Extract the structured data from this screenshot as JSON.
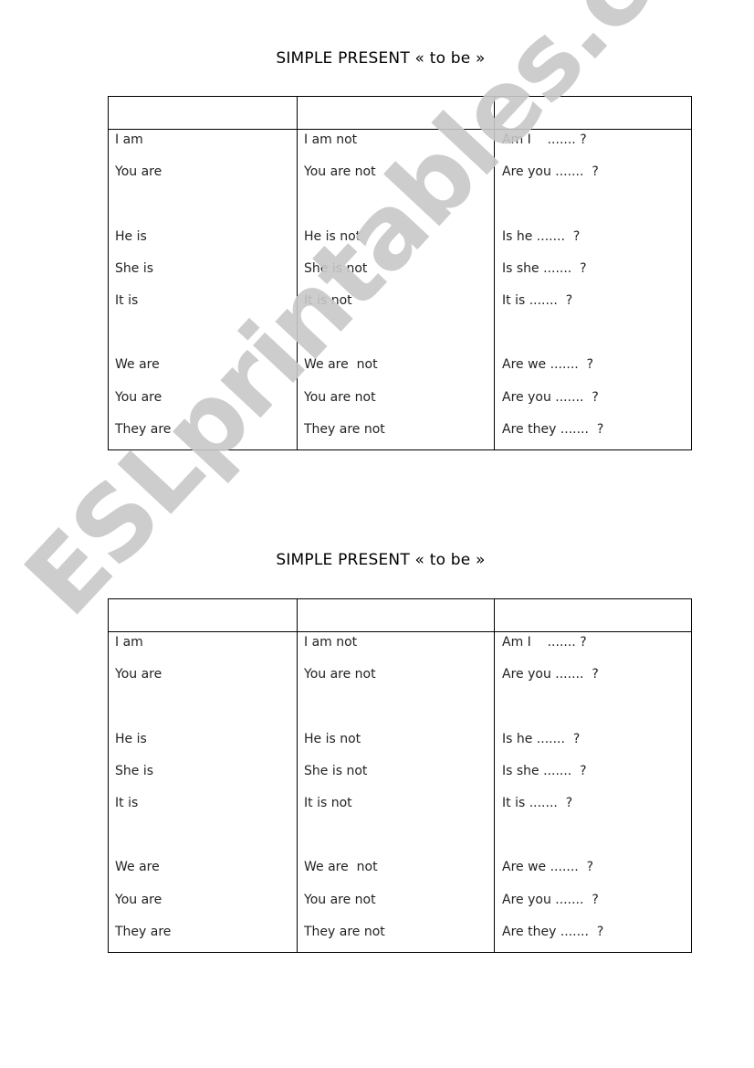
{
  "watermark": "ESLprintables.com",
  "worksheets": [
    {
      "title": "SIMPLE PRESENT «  to be »",
      "headers": [
        "",
        "",
        ""
      ],
      "columns": [
        [
          "I am",
          "You are",
          "",
          "He is",
          "She is",
          "It is",
          "",
          "We are",
          "You are",
          "They are"
        ],
        [
          "I am not",
          "You are not",
          "",
          "He is not",
          "She is not",
          "It is not",
          "",
          "We are  not",
          "You are not",
          "They are not"
        ],
        [
          "Am I    ....... ?",
          "Are you .......  ?",
          "",
          "Is he .......  ?",
          "Is she .......  ?",
          "It is .......  ?",
          "",
          "Are we .......  ?",
          "Are you .......  ?",
          "Are they .......  ?"
        ]
      ]
    },
    {
      "title": "SIMPLE PRESENT «  to be »",
      "headers": [
        "",
        "",
        ""
      ],
      "columns": [
        [
          "I am",
          "You are",
          "",
          "He is",
          "She is",
          "It is",
          "",
          "We are",
          "You are",
          "They are"
        ],
        [
          "I am not",
          "You are not",
          "",
          "He is not",
          "She is not",
          "It is not",
          "",
          "We are  not",
          "You are not",
          "They are not"
        ],
        [
          "Am I    ....... ?",
          "Are you .......  ?",
          "",
          "Is he .......  ?",
          "Is she .......  ?",
          "It is .......  ?",
          "",
          "Are we .......  ?",
          "Are you .......  ?",
          "Are they .......  ?"
        ]
      ]
    }
  ]
}
